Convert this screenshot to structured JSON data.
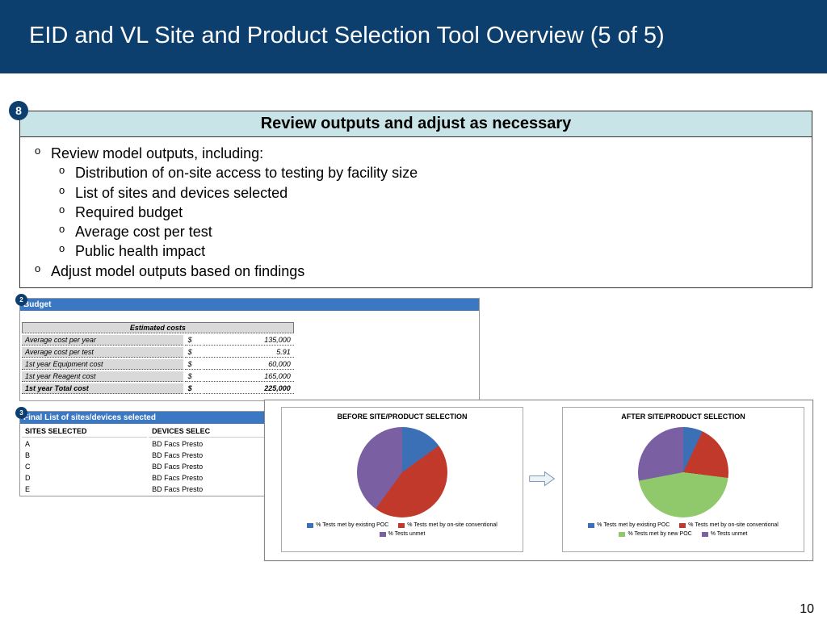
{
  "title": "EID and VL Site and Product Selection Tool Overview (5 of 5)",
  "page_number": "10",
  "step": {
    "badge": "8",
    "header": "Review outputs and adjust as necessary",
    "bullets": {
      "b1": "Review model outputs, including:",
      "subs": {
        "s1": "Distribution of on-site access to testing by facility size",
        "s2": "List of sites and devices selected",
        "s3": "Required budget",
        "s4": "Average cost per test",
        "s5": "Public health impact"
      },
      "b2": "Adjust model outputs based on findings"
    }
  },
  "budget": {
    "badge": "2",
    "title": "Budget",
    "estimated_header": "Estimated costs",
    "rows": {
      "r1": {
        "label": "Average cost per year",
        "cur": "$",
        "val": "135,000"
      },
      "r2": {
        "label": "Average cost per test",
        "cur": "$",
        "val": "5.91"
      },
      "r3": {
        "label": "1st year Equipment cost",
        "cur": "$",
        "val": "60,000"
      },
      "r4": {
        "label": "1st year Reagent cost",
        "cur": "$",
        "val": "165,000"
      },
      "r5": {
        "label": "1st year Total cost",
        "cur": "$",
        "val": "225,000"
      }
    }
  },
  "sites": {
    "badge": "3",
    "title": "Final List of sites/devices selected",
    "col_sites": "SITES SELECTED",
    "col_devices": "DEVICES SELEC",
    "rows": {
      "a": {
        "site": "A",
        "device": "BD Facs Presto"
      },
      "b": {
        "site": "B",
        "device": "BD Facs Presto"
      },
      "c": {
        "site": "C",
        "device": "BD Facs Presto"
      },
      "d": {
        "site": "D",
        "device": "BD Facs Presto"
      },
      "e": {
        "site": "E",
        "device": "BD Facs Presto"
      }
    }
  },
  "charts": {
    "before_title": "BEFORE SITE/PRODUCT SELECTION",
    "after_title": "AFTER SITE/PRODUCT SELECTION",
    "legend": {
      "l1": "% Tests met by existing POC",
      "l2": "% Tests met by on-site conventional",
      "l3": "% Tests met by new POC",
      "l4": "% Tests unmet"
    },
    "colors": {
      "poc_existing": "#3b6fb6",
      "conventional": "#c0392b",
      "poc_new": "#8fc96b",
      "unmet": "#7b5fa3"
    }
  },
  "chart_data": [
    {
      "type": "pie",
      "title": "BEFORE SITE/PRODUCT SELECTION",
      "series": [
        {
          "name": "% Tests met by existing POC",
          "value": 15
        },
        {
          "name": "% Tests met by on-site conventional",
          "value": 45
        },
        {
          "name": "% Tests unmet",
          "value": 40
        }
      ]
    },
    {
      "type": "pie",
      "title": "AFTER SITE/PRODUCT SELECTION",
      "series": [
        {
          "name": "% Tests met by existing POC",
          "value": 7
        },
        {
          "name": "% Tests met by on-site conventional",
          "value": 20
        },
        {
          "name": "% Tests met by new POC",
          "value": 45
        },
        {
          "name": "% Tests unmet",
          "value": 28
        }
      ]
    }
  ]
}
